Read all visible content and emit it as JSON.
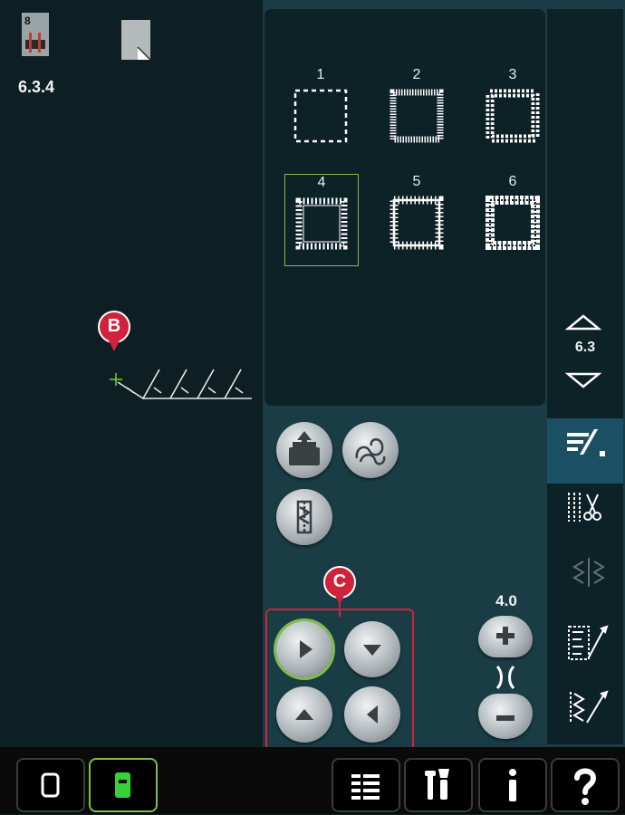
{
  "status": {
    "presser_foot_number": "8",
    "stitch_id": "6.3.4"
  },
  "patch_menu": {
    "stitches": [
      {
        "number": "1"
      },
      {
        "number": "2"
      },
      {
        "number": "3"
      },
      {
        "number": "4"
      },
      {
        "number": "5"
      },
      {
        "number": "6"
      }
    ],
    "selected_index": 3,
    "page_label": "6.3"
  },
  "callouts": {
    "b": "B",
    "c": "C"
  },
  "stitch_width": {
    "value": "4.0"
  },
  "colors": {
    "background": "#0d1f23",
    "panel": "#0c2227",
    "accent_green": "#7fbf4a",
    "callout_red": "#d1223b",
    "sidebar_highlight": "#1b4f63"
  },
  "icons": [
    "load-file-icon",
    "sewing-techniques-icon",
    "mirror-icon",
    "arrow-right-icon",
    "arrow-down-icon",
    "arrow-up-icon",
    "arrow-left-icon",
    "plus-icon",
    "minus-icon",
    "width-icon",
    "stitch-menu-icon",
    "tie-off-icon",
    "mirror-side-icon",
    "sequence-icon",
    "edit-stitch-icon",
    "presser-foot-icon",
    "fabric-icon",
    "scroll-up-icon",
    "scroll-down-icon",
    "stitch-mode-icon",
    "embroidery-mode-icon",
    "menu-list-icon",
    "settings-icon",
    "info-icon",
    "help-icon"
  ]
}
